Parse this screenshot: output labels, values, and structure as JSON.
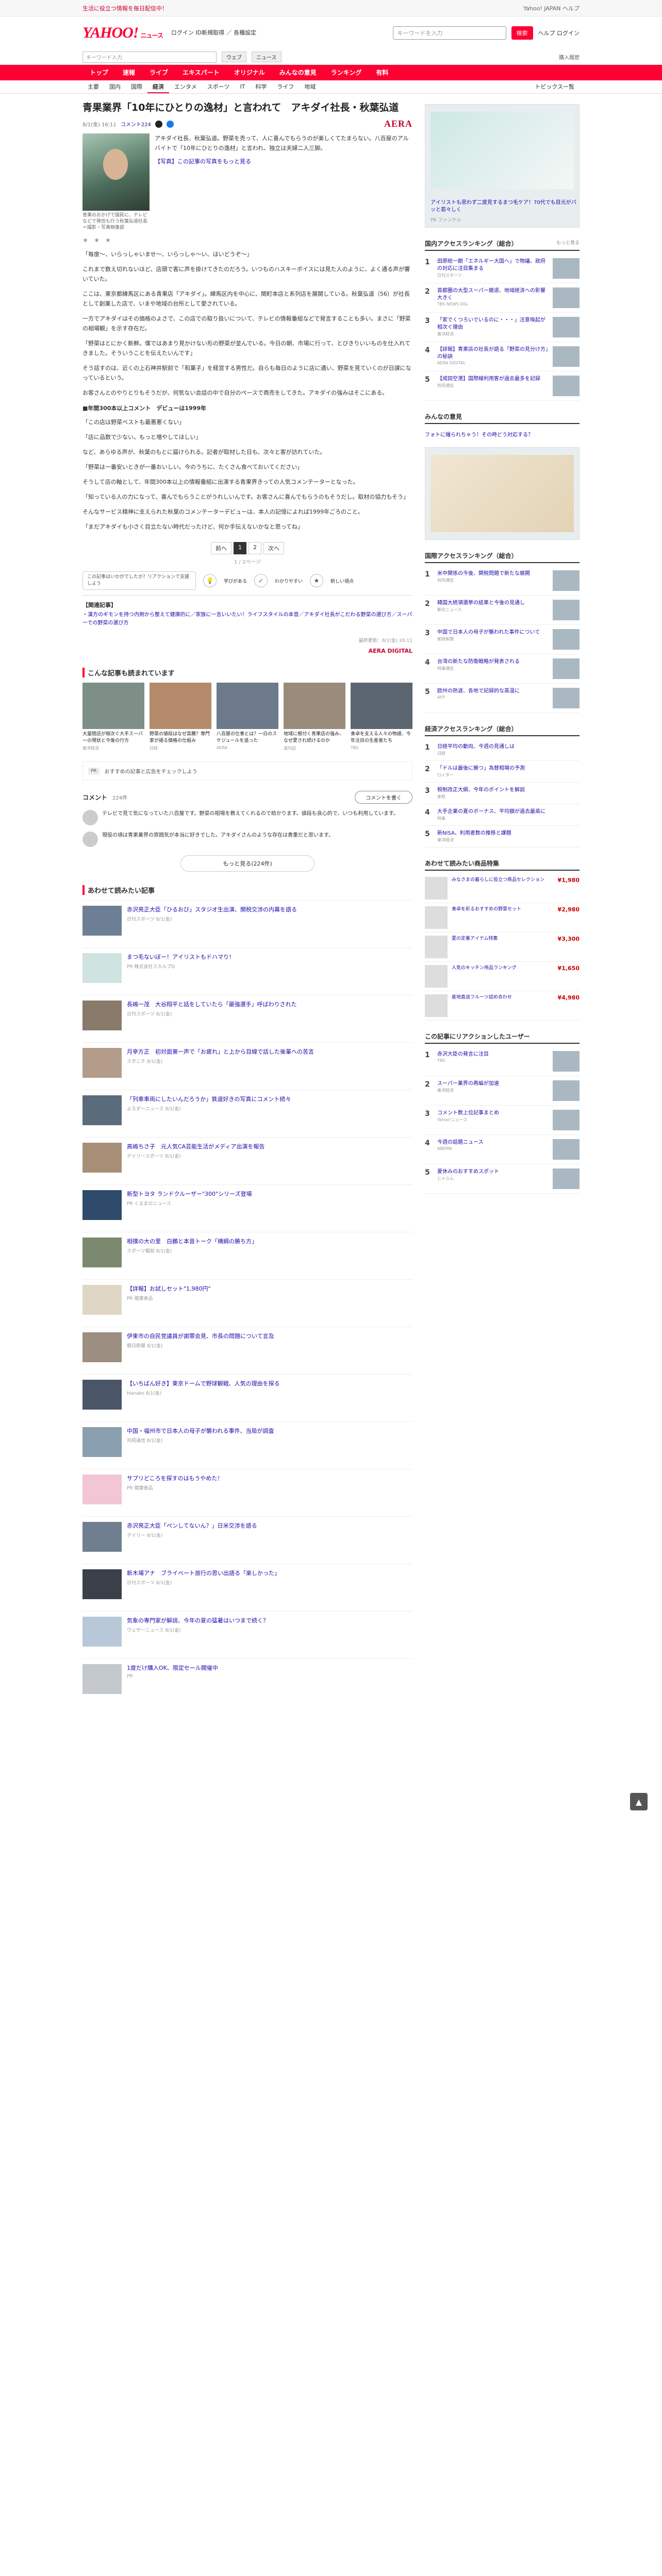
{
  "topbar": {
    "promo": "生活に役立つ情報を毎日配信中！",
    "notice": "Yahoo! JAPAN ヘルプ"
  },
  "header": {
    "logo": "YAHOO!",
    "logo_sub": "ニュース",
    "service_links": "ログイン ID新規取得 ／ 各種設定",
    "search_placeholder": "キーワードを入力",
    "search_label": "検索",
    "right_links": "ヘルプ ログイン"
  },
  "subsearch": {
    "placeholder": "キーワード入力",
    "web": "ウェブ",
    "news": "ニュース",
    "right": "購入履歴"
  },
  "nav": [
    "トップ",
    "速報",
    "ライブ",
    "エキスパート",
    "オリジナル",
    "みんなの意見",
    "ランキング",
    "有料"
  ],
  "subnav": [
    "主要",
    "国内",
    "国際",
    "経済",
    "エンタメ",
    "スポーツ",
    "IT",
    "科学",
    "ライフ",
    "地域"
  ],
  "subnav_right": "トピックス一覧",
  "article": {
    "title": "青果業界「10年にひとりの逸材」と言われて　アキダイ社長・秋葉弘道",
    "date": "8/1(金) 16:11",
    "comment_count": "コメント224",
    "brand": "AERA",
    "caption": "青果のおかげで国民に、テレビなどで発信も行う秋葉弘道社長＝撮影・写真映像部",
    "lead": "アキダイ社長、秋葉弘道。野菜を売って、人に喜んでもらうのが楽しくてたまらない。八百屋のアルバイトで「10年にひとりの逸材」と言われ、独立は夫婦二人三脚。",
    "photo_link": "【写真】この記事の写真をもっと見る",
    "body": [
      "「毎度～、いらっしゃいませ～、いらっしゃ～い、はいどうぞ～」",
      "これまで数え切れないほど、店頭で客に声を掛けてきたのだろう。いつものハスキーボイスには見た人のように、よく通る声が響いていた。",
      "ここは、東京都練馬区にある青果店「アキダイ」。練馬区内を中心に、関町本店と系列店を展開している。秋葉弘道（56）が社長として創業した店で、いまや地域の台所として愛されている。",
      "一方でアキダイはその価格のよさで、この店での取り扱いについて、テレビの情報番組などで発言することも多い。まさに「野菜の相場観」を示す存在だ。",
      "「野菜はとにかく新鮮。僕ではあまり見かけない形の野菜が並んでいる。今日の朝、市場に行って、とびきりいいものを仕入れてきました。そういうことを伝えたいんです」",
      "そう話すのは、近くの上石神井駅前で「和菓子」を経営する男性だ。自らも毎日のように店に通い、野菜を見ていくのが日課になっているという。",
      "お客さんとのやりとりもそうだが、何気ない会話の中で自分のペースで商売をしてきた。アキダイの強みはそこにある。"
    ],
    "subheading": "■年間300本以上コメント　デビューは1999年",
    "body2": [
      "「この店は野菜ベストも最悪悪くない」",
      "「店に品数で少ない。もっと増やしてほしい」",
      "など、あらゆる声が、秋葉のもとに届けられる。記者が取材した日も、次々と客が訪れていた。",
      "「野菜は一番安いときが一番おいしい。今のうちに、たくさん食べておいてください」",
      "そうして店の軸として、年間300本以上の情報番組に出演する青果界きっての人気コメンテーターとなった。",
      "「知っている人の力になって、喜んでもらうことがうれしいんです。お客さんに喜んでもらうのもそうだし。取材の協力もそう」",
      "そんなサービス精神に支えられた秋葉のコメンテーターデビューは、本人の記憶によれば1999年ごろのこと。",
      "「まだアキダイも小さく目立たない時代だったけど、何か手伝えないかなと思ってね」"
    ],
    "pager": [
      "前へ",
      "1",
      "2",
      "次へ"
    ],
    "pager_note": "1 / 2ページ",
    "reaction_prompt": "この記事はいかがでしたか？リアクションで支援しよう",
    "reactions": [
      "学びがある",
      "わかりやすい",
      "新しい視点"
    ],
    "related_title": "【関連記事】",
    "related_links": "・漢方のギモンを持つ内側から整えて健康的に／家族に一言いいたい！ライフスタイルの本音／アキダイ社長がこだわる野菜の選び方／スーパーでの野菜の選び方",
    "footer_meta": "最終更新：8/1(金) 16:11",
    "footer_brand": "AERA DIGITAL"
  },
  "recommend": {
    "heading": "こんな記事も読まれています",
    "cards": [
      {
        "text": "大量閉店が相次ぐ大手スーパーの現状と今後の行方",
        "src": "東洋経済"
      },
      {
        "text": "野菜の値段はなぜ高騰？専門家が語る価格の仕組み",
        "src": "日経"
      },
      {
        "text": "八百屋の仕事とは？一日のスケジュールを追った",
        "src": "AERA"
      },
      {
        "text": "地域に根付く青果店の強み、なぜ愛され続けるのか",
        "src": "週刊誌"
      },
      {
        "text": "食卓を支える人々の物語、今年注目の生産者たち",
        "src": "TBS"
      }
    ]
  },
  "ad_box": {
    "text": "おすすめの記事と広告をチェックしよう",
    "label": "PR"
  },
  "comments": {
    "heading": "コメント",
    "count": "224件",
    "post_button": "コメントを書く",
    "items": [
      "テレビで見て気になっていた八百屋です。野菜の相場を教えてくれるので助かります。値段も良心的で、いつも利用しています。",
      "現役の頃は青果業界の雰囲気が本当に好きでした。アキダイさんのような存在は貴重だと思います。"
    ],
    "more": "もっと見る(224件)"
  },
  "feed": {
    "heading": "あわせて読みたい記事",
    "items": [
      {
        "title": "赤沢亮正大臣「ひるおび」スタジオ生出演、関税交渉の内幕を語る",
        "src": "日刊スポーツ 8/1(金)"
      },
      {
        "title": "まつ毛ないぼー！アイリストもドハマり！",
        "src": "PR 株式会社スカルプD"
      },
      {
        "title": "長嶋一茂　大谷翔平と話をしていたら「最強選手」呼ばわりされた",
        "src": "日刊スポーツ 8/1(金)"
      },
      {
        "title": "月亭方正　初対面第一声で「お疲れ」と上から目線で話した後輩への苦言",
        "src": "スポニチ 8/1(金)"
      },
      {
        "title": "「列車車両にしたいんだろうか」鉄道好きの写真にコメント続々",
        "src": "よろず〜ニュース 8/1(金)"
      },
      {
        "title": "高嶋ちさ子　元人気CA芸能生活がメディア出演を報告",
        "src": "デイリースポーツ 8/1(金)"
      },
      {
        "title": "新型トヨタ ランドクルーザー\"300\"シリーズ登場",
        "src": "PR くるまのニュース"
      },
      {
        "title": "相撲の大の里　白鵬と本音トーク「横綱の勝ち方」",
        "src": "スポーツ報知 8/1(金)"
      },
      {
        "title": "【詳報】お試しセット\"1,980円\"",
        "src": "PR 健康食品"
      },
      {
        "title": "伊東市の自民党議員が謝罪会見、市長の問題について言及",
        "src": "朝日新聞 8/1(金)"
      },
      {
        "title": "【いちばん好き】東京ドームで野球観戦、人気の理由を探る",
        "src": "Hanako 8/1(金)"
      },
      {
        "title": "中国・福州市で日本人の母子が襲われる事件、当局が調査",
        "src": "共同通信 8/1(金)"
      },
      {
        "title": "サプリどころを探すのはもうやめた！",
        "src": "PR 健康食品"
      },
      {
        "title": "赤沢亮正大臣「ペンしてないん？」日米交渉を語る",
        "src": "デイリー 8/1(金)"
      },
      {
        "title": "新木場アナ　ブライベート旅行の思い出語る「楽しかった」",
        "src": "日刊スポーツ 8/1(金)"
      },
      {
        "title": "気象の専門家が解説、今年の夏の猛暑はいつまで続く？",
        "src": "ウェザーニュース 8/1(金)"
      },
      {
        "title": "1度だけ購入OK、限定セール開催中",
        "src": "PR"
      }
    ]
  },
  "side": {
    "ad_caption": "アイリストも思わず二度見するまつ毛ケア！70代でも目元がパッと若々しく",
    "ad_sponsor": "PR ファンケル",
    "ranking_heading": "国内アクセスランキング（総合）",
    "ranking_more": "もっと見る",
    "ranking": [
      {
        "t": "田原総一朗「エネルギー大国へ」で物議、政府の対応に注目集まる",
        "s": "日刊スポーツ"
      },
      {
        "t": "首都圏の大型スーパー撤退、地域経済への影響大きく",
        "s": "TBS NEWS DIG"
      },
      {
        "t": "「家でくつろいでいるのに・・・」注意喚起が相次ぐ理由",
        "s": "東洋経済"
      },
      {
        "t": "【詳報】青果店の社長が語る「野菜の見分け方」の秘訣",
        "s": "AERA DIGITAL"
      },
      {
        "t": "【成田空港】国際線利用客が過去最多を記録",
        "s": "共同通信"
      }
    ],
    "spot_heading": "みんなの意見",
    "spot": "フォトに撮られちゃう！その時どう対応する？",
    "ranking2_heading": "国際アクセスランキング（総合）",
    "ranking2": [
      {
        "t": "米中関係の今後、関税問題で新たな展開",
        "s": "共同通信"
      },
      {
        "t": "韓国大統領選挙の結果と今後の見通し",
        "s": "聯合ニュース"
      },
      {
        "t": "中国で日本人の母子が襲われた事件について",
        "s": "産経新聞"
      },
      {
        "t": "台湾の新たな防衛戦略が発表される",
        "s": "時事通信"
      },
      {
        "t": "欧州の熱波、各地で記録的な高温に",
        "s": "AFP"
      }
    ],
    "ranking3_heading": "経済アクセスランキング（総合）",
    "ranking3": [
      {
        "t": "日経平均の動向、今週の見通しは",
        "s": "日経"
      },
      {
        "t": "「ドルは最後に勝つ」為替相場の予測",
        "s": "ロイター"
      },
      {
        "t": "税制改正大綱、今年のポイントを解説",
        "s": "産経"
      },
      {
        "t": "大手企業の夏のボーナス、平均額が過去最高に",
        "s": "時事"
      },
      {
        "t": "新NISA、利用者数の推移と課題",
        "s": "東洋経済"
      }
    ],
    "shop_heading": "あわせて読みたい商品特集",
    "products": [
      {
        "t": "みなさまの暮らしに役立つ商品セレクション",
        "p": "¥1,980"
      },
      {
        "t": "食卓を彩るおすすめの野菜セット",
        "p": "¥2,980"
      },
      {
        "t": "夏の定番アイテム特集",
        "p": "¥3,300"
      },
      {
        "t": "人気のキッチン用品ランキング",
        "p": "¥1,650"
      },
      {
        "t": "産地直送フルーツ詰め合わせ",
        "p": "¥4,980"
      }
    ],
    "pickup_heading": "この記事にリアクションしたユーザー",
    "pickup": [
      {
        "t": "赤沢大臣の発言に注目",
        "s": "TBS"
      },
      {
        "t": "スーパー業界の再編が加速",
        "s": "東洋経済"
      },
      {
        "t": "コメント数上位記事まとめ",
        "s": "Yahoo!ニュース"
      },
      {
        "t": "今週の話題ニュース",
        "s": "ABEMA"
      },
      {
        "t": "夏休みのおすすめスポット",
        "s": "じゃらん"
      }
    ]
  },
  "colors": {
    "brand_red": "#ff0033",
    "link_blue": "#1a0dab",
    "aera_red": "#c4002f"
  }
}
